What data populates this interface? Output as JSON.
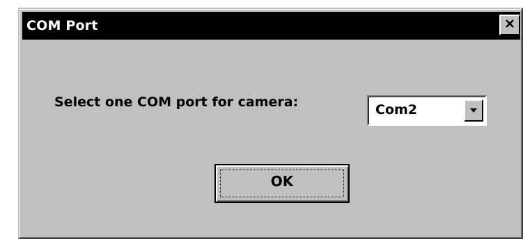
{
  "window": {
    "title": "COM Port",
    "close_icon": "close-icon"
  },
  "form": {
    "prompt": "Select one COM port for camera:",
    "com_port": {
      "selected": "Com2",
      "arrow_icon": "chevron-down-icon"
    },
    "ok_label": "OK"
  },
  "colors": {
    "face": "#c0c0c0",
    "titlebar": "#000000",
    "title_text": "#ffffff"
  }
}
